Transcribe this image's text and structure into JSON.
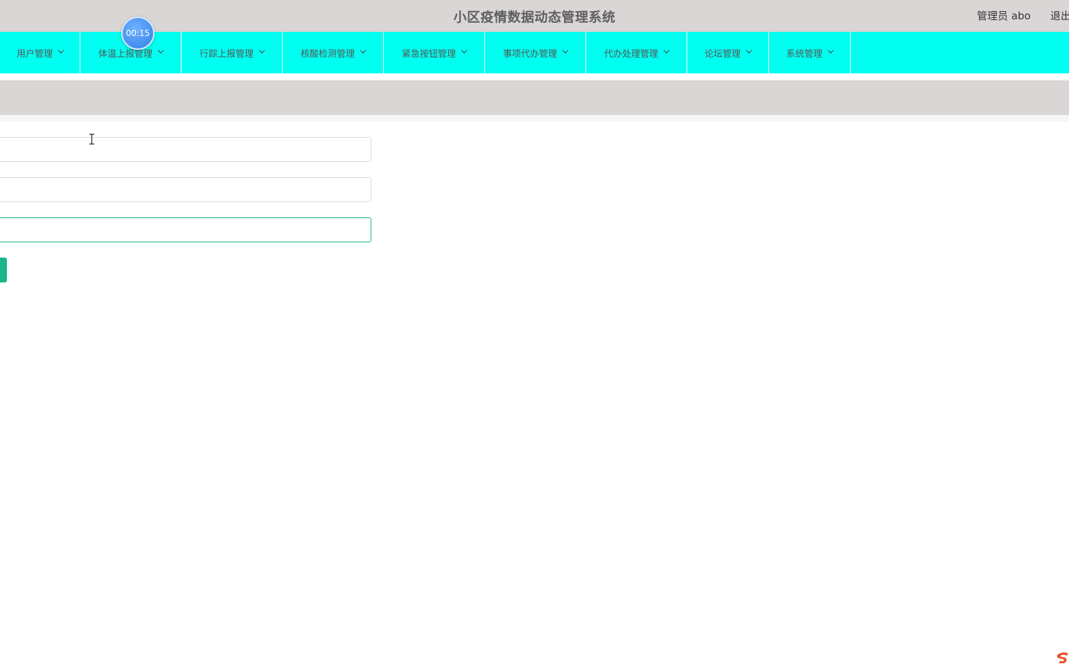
{
  "header": {
    "title": "小区疫情数据动态管理系统",
    "user_label": "管理员 abo",
    "logout_label": "退出"
  },
  "timer": {
    "text": "00:15"
  },
  "nav": {
    "items": [
      {
        "label": "用户管理",
        "icon": "chevron-down-icon"
      },
      {
        "label": "体温上报管理",
        "icon": "chevron-down-icon"
      },
      {
        "label": "行踪上报管理",
        "icon": "chevron-down-icon"
      },
      {
        "label": "核酸检测管理",
        "icon": "chevron-down-icon"
      },
      {
        "label": "紧急按钮管理",
        "icon": "chevron-down-icon"
      },
      {
        "label": "事项代办管理",
        "icon": "chevron-down-icon"
      },
      {
        "label": "代办处理管理",
        "icon": "chevron-down-icon"
      },
      {
        "label": "论坛管理",
        "icon": "chevron-down-icon"
      },
      {
        "label": "系统管理",
        "icon": "chevron-down-icon"
      }
    ]
  },
  "form": {
    "fields": [
      {
        "value": "",
        "placeholder": ""
      },
      {
        "value": "",
        "placeholder": ""
      },
      {
        "value": "",
        "placeholder": ""
      }
    ],
    "submit_label": ""
  },
  "colors": {
    "topbar": "#dad6d6",
    "nav_background": "#00fff0",
    "accent": "#18b68a",
    "timer": "#2f7fe6"
  }
}
